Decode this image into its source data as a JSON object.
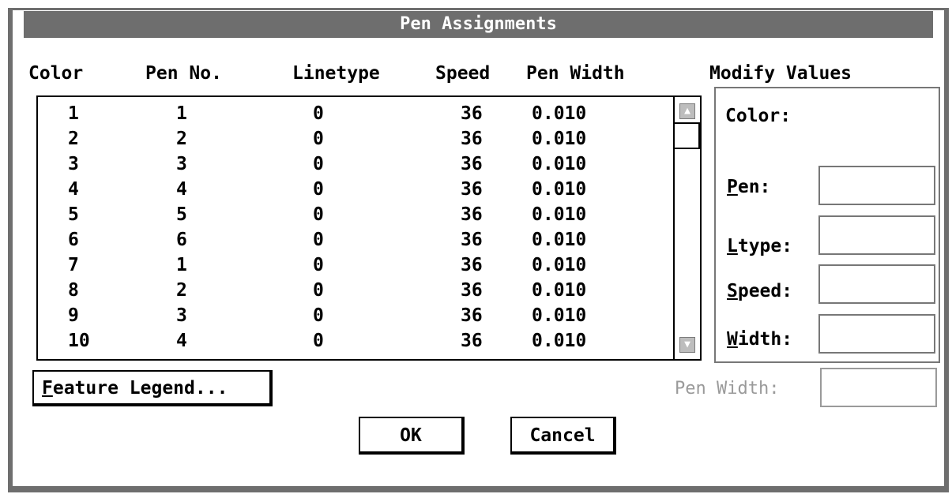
{
  "window": {
    "title": "Pen Assignments"
  },
  "columns": [
    "Color",
    "Pen No.",
    "Linetype",
    "Speed",
    "Pen Width"
  ],
  "rows": [
    [
      "1",
      "1",
      "0",
      "36",
      "0.010"
    ],
    [
      "2",
      "2",
      "0",
      "36",
      "0.010"
    ],
    [
      "3",
      "3",
      "0",
      "36",
      "0.010"
    ],
    [
      "4",
      "4",
      "0",
      "36",
      "0.010"
    ],
    [
      "5",
      "5",
      "0",
      "36",
      "0.010"
    ],
    [
      "6",
      "6",
      "0",
      "36",
      "0.010"
    ],
    [
      "7",
      "1",
      "0",
      "36",
      "0.010"
    ],
    [
      "8",
      "2",
      "0",
      "36",
      "0.010"
    ],
    [
      "9",
      "3",
      "0",
      "36",
      "0.010"
    ],
    [
      "10",
      "4",
      "0",
      "36",
      "0.010"
    ]
  ],
  "modify": {
    "title": "Modify Values",
    "color_label": "Color:",
    "pen_label_hot": "P",
    "pen_label_rest": "en:",
    "ltype_label_hot": "L",
    "ltype_label_rest": "type:",
    "speed_label_hot": "S",
    "speed_label_rest": "peed:",
    "width_label_hot": "W",
    "width_label_rest": "idth:",
    "pen_value": "",
    "ltype_value": "",
    "speed_value": "",
    "width_value": ""
  },
  "pen_width": {
    "label": "Pen Width:",
    "value": ""
  },
  "buttons": {
    "feature_legend_hot": "F",
    "feature_legend_rest": "eature Legend...",
    "ok": "OK",
    "cancel": "Cancel"
  },
  "icons": {
    "scroll_up": "arrow-up-icon",
    "scroll_down": "arrow-down-icon"
  },
  "colors": {
    "titlebar": "#6e6e6e",
    "disabled_text": "#9a9a9a"
  }
}
